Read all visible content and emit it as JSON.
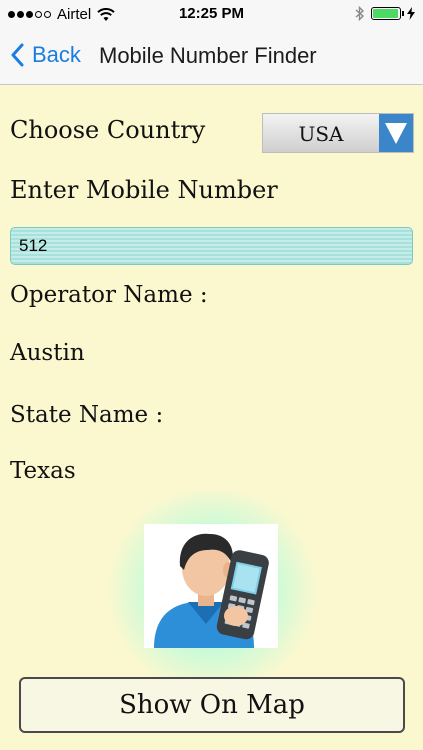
{
  "status": {
    "carrier": "Airtel",
    "time": "12:25 PM",
    "signal_bars_filled": 3,
    "signal_bars_total": 5,
    "battery_level": 0.95,
    "accent_green": "#4cd964"
  },
  "nav": {
    "back_label": "Back",
    "title": "Mobile Number Finder",
    "accent": "#1a7de0"
  },
  "form": {
    "country_label": "Choose Country",
    "country_value": "USA",
    "number_label": "Enter Mobile Number",
    "number_value": "512"
  },
  "result": {
    "operator_label": "Operator Name :",
    "operator_value": "Austin",
    "state_label": "State Name :",
    "state_value": "Texas"
  },
  "image": {
    "icon": "person-with-phone-icon"
  },
  "actions": {
    "map_button": "Show On Map"
  }
}
